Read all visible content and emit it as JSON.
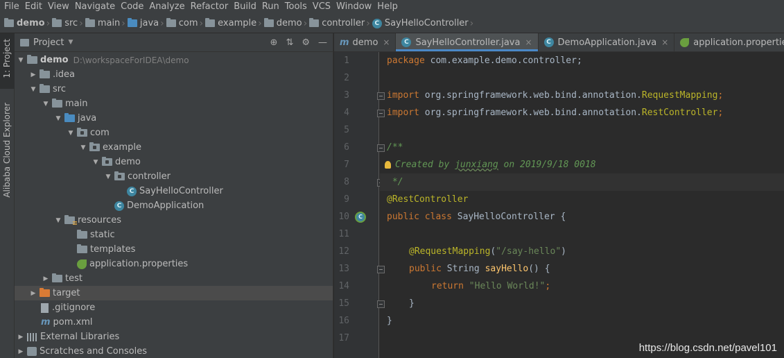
{
  "menu": [
    "File",
    "Edit",
    "View",
    "Navigate",
    "Code",
    "Analyze",
    "Refactor",
    "Build",
    "Run",
    "Tools",
    "VCS",
    "Window",
    "Help"
  ],
  "breadcrumb": [
    {
      "label": "demo",
      "icon": "module-folder-icon"
    },
    {
      "label": "src",
      "icon": "folder-icon"
    },
    {
      "label": "main",
      "icon": "folder-icon"
    },
    {
      "label": "java",
      "icon": "source-folder-icon"
    },
    {
      "label": "com",
      "icon": "package-icon"
    },
    {
      "label": "example",
      "icon": "package-icon"
    },
    {
      "label": "demo",
      "icon": "package-icon"
    },
    {
      "label": "controller",
      "icon": "package-icon"
    },
    {
      "label": "SayHelloController",
      "icon": "class-icon"
    }
  ],
  "left_strip": {
    "project_tab": "1: Project",
    "cloud_tab": "Alibaba Cloud Explorer"
  },
  "project_panel": {
    "title": "Project",
    "tree": [
      {
        "label": "demo",
        "path": "D:\\workspaceForIDEA\\demo",
        "bold": true
      },
      {
        "label": ".idea"
      },
      {
        "label": "src"
      },
      {
        "label": "main"
      },
      {
        "label": "java"
      },
      {
        "label": "com"
      },
      {
        "label": "example"
      },
      {
        "label": "demo"
      },
      {
        "label": "controller"
      },
      {
        "label": "SayHelloController"
      },
      {
        "label": "DemoApplication"
      },
      {
        "label": "resources"
      },
      {
        "label": "static"
      },
      {
        "label": "templates"
      },
      {
        "label": "application.properties"
      },
      {
        "label": "test"
      },
      {
        "label": "target"
      },
      {
        "label": ".gitignore"
      },
      {
        "label": "pom.xml"
      },
      {
        "label": "External Libraries"
      },
      {
        "label": "Scratches and Consoles"
      }
    ]
  },
  "editor": {
    "tabs": [
      {
        "label": "demo",
        "icon": "maven-icon"
      },
      {
        "label": "SayHelloController.java",
        "icon": "class-icon",
        "active": true
      },
      {
        "label": "DemoApplication.java",
        "icon": "spring-boot-class-icon"
      },
      {
        "label": "application.properties",
        "icon": "spring-leaf-icon"
      }
    ],
    "line_numbers": [
      "1",
      "2",
      "3",
      "4",
      "5",
      "6",
      "7",
      "8",
      "9",
      "10",
      "11",
      "12",
      "13",
      "14",
      "15",
      "16",
      "17"
    ],
    "code": {
      "l1_kw": "package",
      "l1_rest": " com.example.demo.controller;",
      "l3_kw": "import",
      "l3_pkg": " org.springframework.web.bind.annotation.",
      "l3_cls": "RequestMapping",
      "l3_end": ";",
      "l4_kw": "import",
      "l4_pkg": " org.springframework.web.bind.annotation.",
      "l4_cls": "RestController",
      "l4_end": ";",
      "l6": "/**",
      "l7_a": "Created by ",
      "l7_user": "junxiang",
      "l7_b": " on 2019/9/18 0018",
      "l8": " */",
      "l9": "@RestController",
      "l10_kw": "public class",
      "l10_rest": " SayHelloController {",
      "l12_ann": "@RequestMapping",
      "l12_open": "(",
      "l12_str": "\"/say-hello\"",
      "l12_close": ")",
      "l13_kw": "public",
      "l13_type": " String ",
      "l13_fn": "sayHello",
      "l13_rest": "() {",
      "l14_kw": "return",
      "l14_str": " \"Hello World!\"",
      "l14_end": ";",
      "l15": "}",
      "l16": "}"
    }
  },
  "watermark": "https://blog.csdn.net/pavel101"
}
